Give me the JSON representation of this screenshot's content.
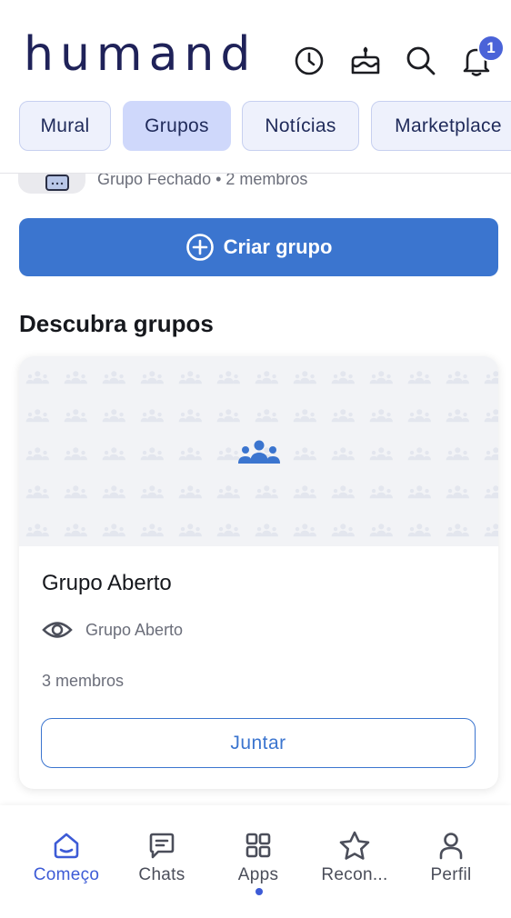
{
  "app": {
    "logo": "humand"
  },
  "header": {
    "icons": [
      "history-icon",
      "birthday-cake-icon",
      "search-icon",
      "bell-icon"
    ],
    "notification_count": "1",
    "accent": "#4a63d8"
  },
  "tabs": [
    {
      "label": "Mural",
      "active": false
    },
    {
      "label": "Grupos",
      "active": true
    },
    {
      "label": "Notícias",
      "active": false
    },
    {
      "label": "Marketplace",
      "active": false
    }
  ],
  "previous_group": {
    "meta": "Grupo Fechado • 2 membros"
  },
  "create_button": {
    "label": "Criar grupo",
    "color": "#3b75cf"
  },
  "discover": {
    "title": "Descubra grupos",
    "card": {
      "title": "Grupo Aberto",
      "privacy": "Grupo Aberto",
      "members": "3 membros",
      "join_label": "Juntar"
    }
  },
  "bottom_nav": [
    {
      "label": "Começo",
      "icon": "home-icon",
      "active": true
    },
    {
      "label": "Chats",
      "icon": "chat-icon",
      "active": false
    },
    {
      "label": "Apps",
      "icon": "apps-grid-icon",
      "active": false
    },
    {
      "label": "Recon...",
      "icon": "star-icon",
      "active": false
    },
    {
      "label": "Perfil",
      "icon": "profile-icon",
      "active": false
    }
  ]
}
